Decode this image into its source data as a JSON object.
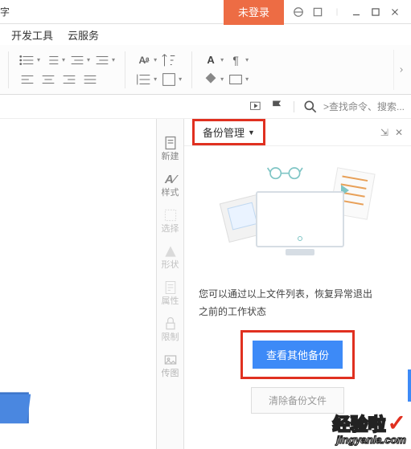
{
  "titlebar": {
    "partial": "字",
    "login": "未登录"
  },
  "menubar": {
    "dev": "开发工具",
    "cloud": "云服务"
  },
  "subbar": {
    "search": ">查找命令、搜索..."
  },
  "sidepanel": {
    "new": "新建",
    "style": "样式",
    "select": "选择",
    "shape": "形状",
    "props": "属性",
    "limit": "限制",
    "img": "传图"
  },
  "backup": {
    "title": "备份管理",
    "msg1": "您可以通过以上文件列表，恢复异常退出",
    "msg2": "之前的工作状态",
    "view_btn": "查看其他备份",
    "clear_btn": "清除备份文件"
  },
  "watermark": {
    "big": "经验啦",
    "small": "jingyanla.com"
  }
}
